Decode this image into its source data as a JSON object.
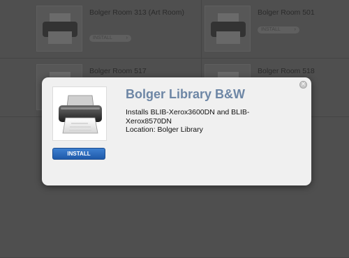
{
  "background": {
    "printers": [
      {
        "name": "Bolger Room 313 (Art Room)",
        "button": "INSTALL"
      },
      {
        "name": "Bolger Room 501",
        "button": "INSTALL"
      },
      {
        "name": "Bolger Room 517",
        "button": ""
      },
      {
        "name": "Bolger Room 518",
        "button": ""
      }
    ]
  },
  "modal": {
    "title": "Bolger Library B&W",
    "description_line1": "Installs BLIB-Xerox3600DN and BLIB-Xerox8570DN",
    "location": "Location: Bolger Library",
    "install_label": "INSTALL",
    "close_symbol": "×",
    "icon": "printer-icon"
  },
  "colors": {
    "title_blue": "#6d86a5",
    "install_button": "#2a6cc4",
    "overlay": "#4f4f4f"
  }
}
